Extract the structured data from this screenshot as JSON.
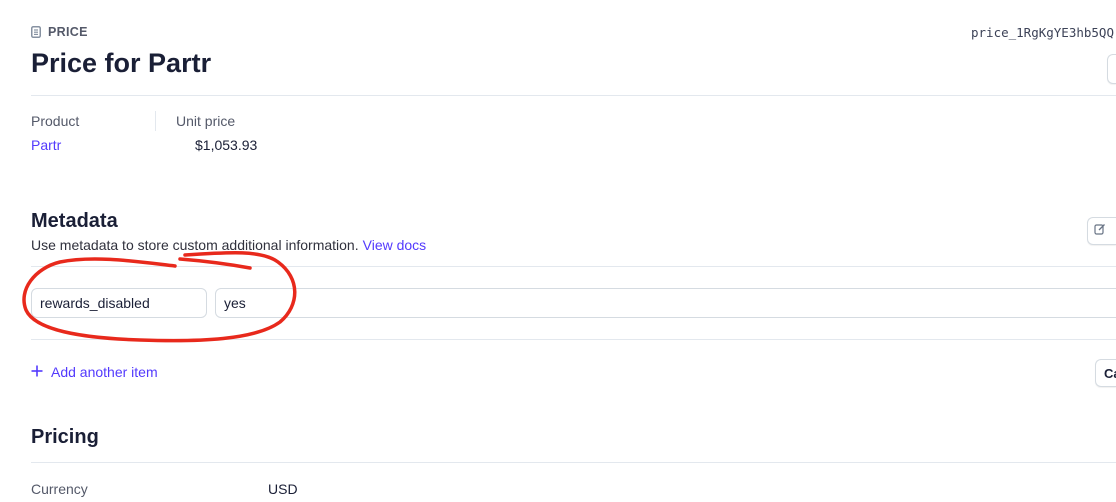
{
  "header": {
    "eyebrow": "PRICE",
    "price_id": "price_1RgKgYE3hb5QQ",
    "title": "Price for Partr"
  },
  "summary": {
    "product_label": "Product",
    "product_value": "Partr",
    "unit_price_label": "Unit price",
    "unit_price_value": "$1,053.93"
  },
  "metadata": {
    "heading": "Metadata",
    "description": "Use metadata to store custom additional information.",
    "docs_link": "View docs",
    "items": [
      {
        "key": "rewards_disabled",
        "value": "yes"
      }
    ],
    "add_label": "Add another item",
    "right_button_label": "Ca"
  },
  "pricing": {
    "heading": "Pricing",
    "currency_label": "Currency",
    "currency_value": "USD"
  },
  "annotation": {
    "color": "#e8291c"
  },
  "colors": {
    "accent": "#533afd",
    "text": "#1a1f36",
    "muted": "#545969",
    "border": "#e3e8ee"
  }
}
